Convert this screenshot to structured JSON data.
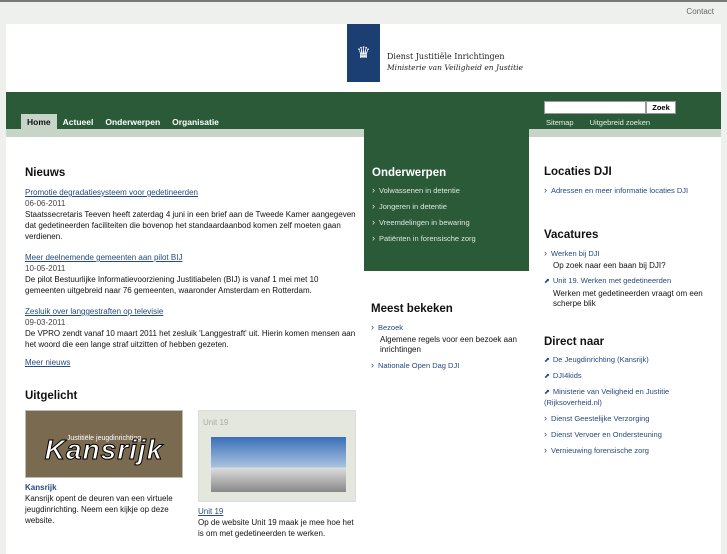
{
  "top": {
    "contact": "Contact"
  },
  "logo": {
    "line1": "Dienst Justitiële Inrichtingen",
    "line2": "Ministerie van Veiligheid en Justitie"
  },
  "nav": {
    "tabs": [
      "Home",
      "Actueel",
      "Onderwerpen",
      "Organisatie"
    ],
    "active": "Home"
  },
  "search": {
    "value": "",
    "button": "Zoek",
    "links": [
      "Sitemap",
      "Uitgebreid zoeken"
    ]
  },
  "news": {
    "title": "Nieuws",
    "items": [
      {
        "title": "Promotie degradatiesysteem voor gedetineerden",
        "date": "06-06-2011",
        "text": "Staatssecretaris Teeven heeft zaterdag 4 juni in een brief aan de Tweede Kamer aangegeven dat gedetineerden faciliteiten die bovenop het standaardaanbod komen zelf moeten gaan verdienen."
      },
      {
        "title": "Meer deelnemende gemeenten aan pilot BIJ",
        "date": "10-05-2011",
        "text": "De pilot Bestuurlijke Informatievoorziening Justitiabelen (BIJ) is vanaf 1 mei met 10 gemeenten uitgebreid naar 76 gemeenten, waaronder Amsterdam en Rotterdam."
      },
      {
        "title": "Zesluik over langgestraften op televisie",
        "date": "09-03-2011",
        "text": "De VPRO zendt vanaf 10 maart 2011 het zesluik 'Langgestraft' uit. Hierin komen mensen aan het woord die een lange straf uitzitten of hebben gezeten."
      }
    ],
    "more": "Meer nieuws"
  },
  "onderwerpen": {
    "title": "Onderwerpen",
    "items": [
      "Volwassenen in detentie",
      "Jongeren in detentie",
      "Vreemdelingen in bewaring",
      "Patiënten in forensische zorg"
    ]
  },
  "meest": {
    "title": "Meest bekeken",
    "items": [
      {
        "title": "Bezoek",
        "text": "Algemene regels voor een bezoek aan inrichtingen"
      },
      {
        "title": "Nationale Open Dag DJI"
      }
    ]
  },
  "uitgelicht": {
    "title": "Uitgelicht",
    "cards": [
      {
        "img_small": "Justitiële jeugdinrichting",
        "img_big": "Kansrijk",
        "title": "Kansrijk",
        "text": "Kansrijk opent de deuren van een virtuele jeugdinrichting. Neem een kijkje op deze website."
      },
      {
        "img_small": "Unit 19",
        "title": "Unit 19",
        "text": "Op de website Unit 19 maak je mee hoe het is om met gedetineerden te werken."
      }
    ]
  },
  "locaties": {
    "title": "Locaties DJI",
    "link": "Adressen en meer informatie locaties DJI"
  },
  "vacatures": {
    "title": "Vacatures",
    "items": [
      {
        "title": "Werken bij DJI",
        "text": "Op zoek naar een baan bij DJI?"
      },
      {
        "title": "Unit 19. Werken met gedetineerden",
        "text": "Werken met gedetineerden vraagt om een scherpe blik"
      }
    ]
  },
  "direct": {
    "title": "Direct naar",
    "items": [
      "De Jeugdinrichting (Kansrijk)",
      "DJI4kids",
      "Ministerie van Veiligheid en Justitie (Rijksoverheid.nl)",
      "Dienst Geestelijke Verzorging",
      "Dienst Vervoer en Ondersteuning",
      "Vernieuwing forensische zorg"
    ]
  }
}
